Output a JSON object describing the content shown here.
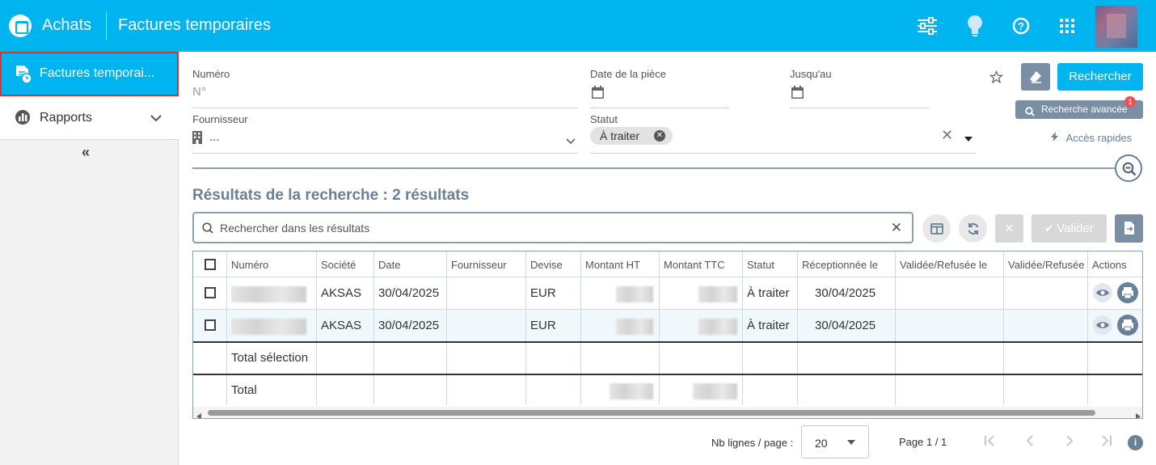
{
  "header": {
    "app_title": "Achats",
    "page_title": "Factures temporaires"
  },
  "sidebar": {
    "items": [
      {
        "label": "Factures temporai...",
        "icon": "invoice-clock-icon",
        "active": true
      },
      {
        "label": "Rapports",
        "icon": "chart-icon",
        "active": false
      }
    ],
    "collapse": "«"
  },
  "form": {
    "numero": {
      "label": "Numéro",
      "placeholder": "N°"
    },
    "date_piece": {
      "label": "Date de la pièce"
    },
    "jusqu_au": {
      "label": "Jusqu'au"
    },
    "fournisseur": {
      "label": "Fournisseur",
      "value": "..."
    },
    "statut": {
      "label": "Statut",
      "chip": "À traiter"
    },
    "search_button": "Rechercher",
    "advanced_button": "Recherche avancée",
    "advanced_badge": "1",
    "quick_access": "Accès rapides"
  },
  "results": {
    "title": "Résultats de la recherche : 2 résultats",
    "search_placeholder": "Rechercher dans les résultats",
    "validate_button": "Valider"
  },
  "table": {
    "headers": [
      "Numéro",
      "Société",
      "Date",
      "Fournisseur",
      "Devise",
      "Montant HT",
      "Montant TTC",
      "Statut",
      "Réceptionnée le",
      "Validée/Refusée le",
      "Validée/Refusée p",
      "Actions"
    ],
    "rows": [
      {
        "societe": "AKSAS",
        "date": "30/04/2025",
        "devise": "EUR",
        "statut": "À traiter",
        "receptionnee": "30/04/2025"
      },
      {
        "societe": "AKSAS",
        "date": "30/04/2025",
        "devise": "EUR",
        "statut": "À traiter",
        "receptionnee": "30/04/2025"
      }
    ],
    "total_selection": "Total sélection",
    "total": "Total"
  },
  "pagination": {
    "rows_label": "Nb lignes / page :",
    "rows_value": "20",
    "page_info": "Page 1 / 1"
  },
  "colors": {
    "primary": "#00b4f0",
    "slate": "#6a7f98",
    "alert": "#f05050"
  }
}
